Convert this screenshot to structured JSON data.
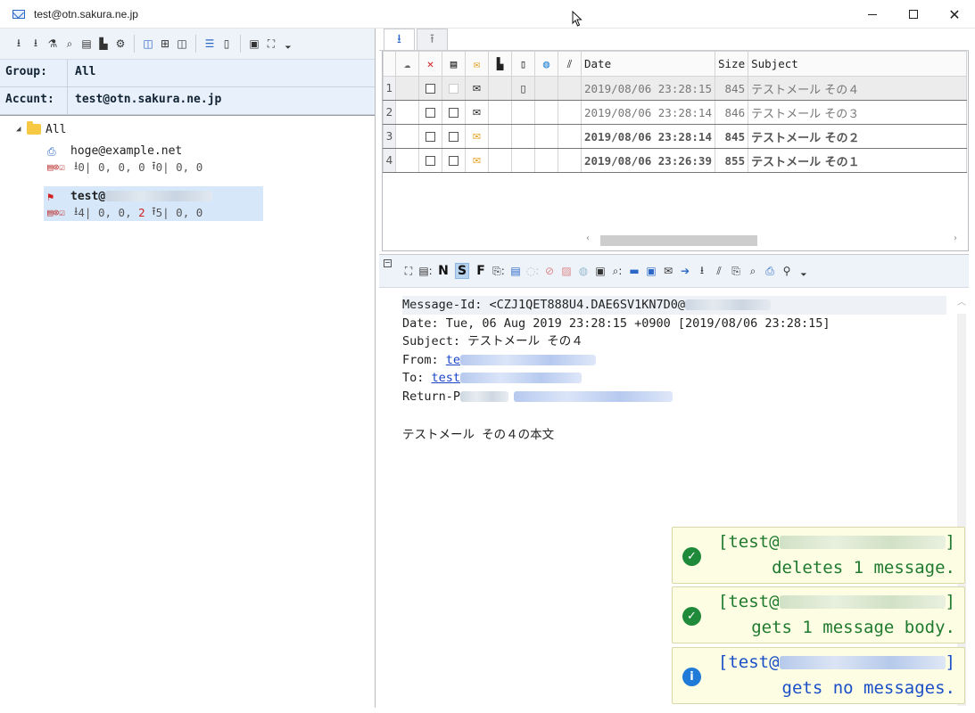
{
  "window": {
    "title": "test@otn.sakura.ne.jp"
  },
  "left": {
    "group_label": "Group:",
    "group_value": "All",
    "account_label": "Accunt:",
    "account_value": "test@otn.sakura.ne.jp",
    "tree": {
      "root": "All",
      "accounts": [
        {
          "name": "hoge@example.net",
          "stats_in": "0",
          "stats_in_rest": "| 0, 0, 0 ",
          "stats_out": "0",
          "stats_out_rest": "| 0, 0"
        },
        {
          "name_prefix": "test@",
          "stats_in": "4",
          "stats_in_rest1": "| 0, 0, ",
          "stats_in_red": "2",
          "stats_in_rest2": " ",
          "stats_out": "5",
          "stats_out_rest": "| 0, 0"
        }
      ]
    }
  },
  "list": {
    "columns": {
      "date": "Date",
      "size": "Size",
      "subject": "Subject"
    },
    "rows": [
      {
        "num": "1",
        "date": "2019/08/06 23:28:15",
        "size": "845",
        "subject": "テストメール その４"
      },
      {
        "num": "2",
        "date": "2019/08/06 23:28:14",
        "size": "846",
        "subject": "テストメール その３"
      },
      {
        "num": "3",
        "date": "2019/08/06 23:28:14",
        "size": "845",
        "subject": "テストメール その２"
      },
      {
        "num": "4",
        "date": "2019/08/06 23:26:39",
        "size": "855",
        "subject": "テストメール その１"
      }
    ]
  },
  "viewer_toolbar": {
    "n": "N",
    "s": "S",
    "f": "F"
  },
  "message": {
    "message_id": "Message-Id: <CZJ1QET888U4.DAE6SV1KN7D0@",
    "date": "Date: Tue, 06 Aug 2019 23:28:15 +0900 [2019/08/06 23:28:15]",
    "subject": "Subject: テストメール その４",
    "from_label": "From: ",
    "from_link": "te",
    "to_label": "To: ",
    "to_link": "test",
    "return_path": "Return-P",
    "body": "テストメール その４の本文"
  },
  "toasts": [
    {
      "prefix": "[test@",
      "suffix": "]",
      "message": "deletes 1 message.",
      "status": "success"
    },
    {
      "prefix": "[test@",
      "suffix": "]",
      "message": "gets 1 message body.",
      "status": "success"
    },
    {
      "prefix": "[test@",
      "suffix": "]",
      "message": "gets no messages.",
      "status": "info"
    }
  ],
  "colors": {
    "accent": "#2b67c7",
    "link": "#1a44c8",
    "toast_bg": "#fdfde3",
    "success": "#1f8a3a",
    "info": "#1f7ad8"
  }
}
